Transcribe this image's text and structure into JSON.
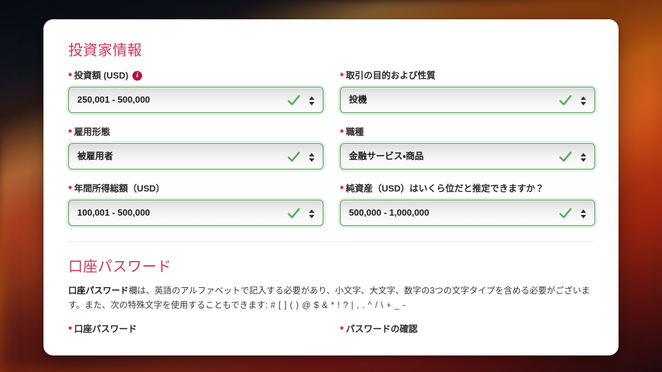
{
  "theme": {
    "heading_color": "#c8365a",
    "required_star_color": "#d0021b",
    "valid_border_color": "#4e9b4e",
    "check_color": "#4fb14f",
    "info_badge_color": "#b3143b",
    "card_background": "#ffffff",
    "divider_color": "#e6e6e6"
  },
  "investor_section": {
    "heading": "投資家情報",
    "fields": [
      {
        "label": "投資額 (USD)",
        "required_mark": "*",
        "has_info_icon": true,
        "info_icon_glyph": "i",
        "value": "250,001 - 500,000",
        "state": "valid"
      },
      {
        "label": "取引の目的および性質",
        "required_mark": "*",
        "has_info_icon": false,
        "value": "投機",
        "state": "valid"
      },
      {
        "label": "雇用形態",
        "required_mark": "*",
        "has_info_icon": false,
        "value": "被雇用者",
        "state": "valid"
      },
      {
        "label": "職種",
        "required_mark": "*",
        "has_info_icon": false,
        "value": "金融サービス・商品",
        "state": "valid"
      },
      {
        "label": "年間所得総額（USD）",
        "required_mark": "*",
        "has_info_icon": false,
        "value": "100,001 - 500,000",
        "state": "valid"
      },
      {
        "label": "純資産（USD）はいくら位だと推定できますか？",
        "required_mark": "*",
        "has_info_icon": false,
        "value": "500,000 - 1,000,000",
        "state": "valid"
      }
    ]
  },
  "password_section": {
    "heading": "口座パスワード",
    "note_bold_lead": "口座パスワード",
    "note_rest": "欄は、英語のアルファベットで記入する必要があり、小文字、大文字、数字の3つの文字タイプを含める必要がございます。また、次の特殊文字を使用することもできます:",
    "note_specials": " # [ ] ( ) @ $ & * ! ? | , . ^ / \\ + _ -",
    "fields": [
      {
        "label": "口座パスワード",
        "required_mark": "*"
      },
      {
        "label": "パスワードの確認",
        "required_mark": "*"
      }
    ]
  }
}
